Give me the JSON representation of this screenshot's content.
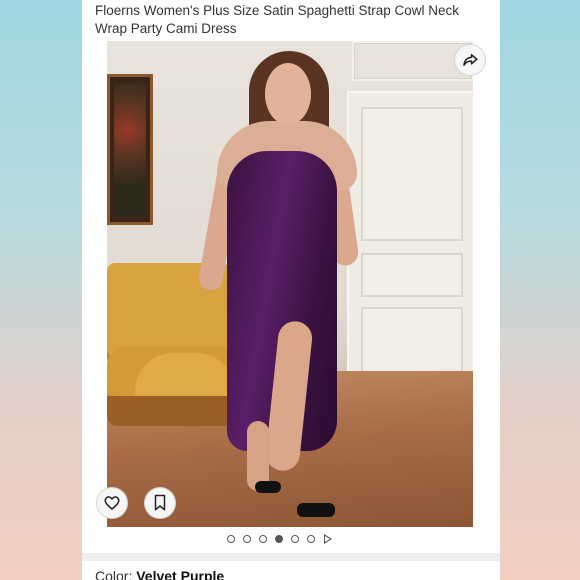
{
  "product": {
    "title": "Floerns Women's Plus Size Satin Spaghetti Strap Cowl Neck Wrap Party Cami Dress",
    "color_label": "Color:",
    "color_value": "Velvet Purple"
  },
  "gallery": {
    "image_count": 6,
    "active_index": 3,
    "has_video": true
  },
  "icons": {
    "share": "share-arrow-icon",
    "favorite": "heart-icon",
    "save": "bookmark-icon",
    "video": "play-icon"
  },
  "colors": {
    "dress": "#4a1756",
    "background_top": "#9fd6e0",
    "background_bottom": "#f2cfc1"
  }
}
